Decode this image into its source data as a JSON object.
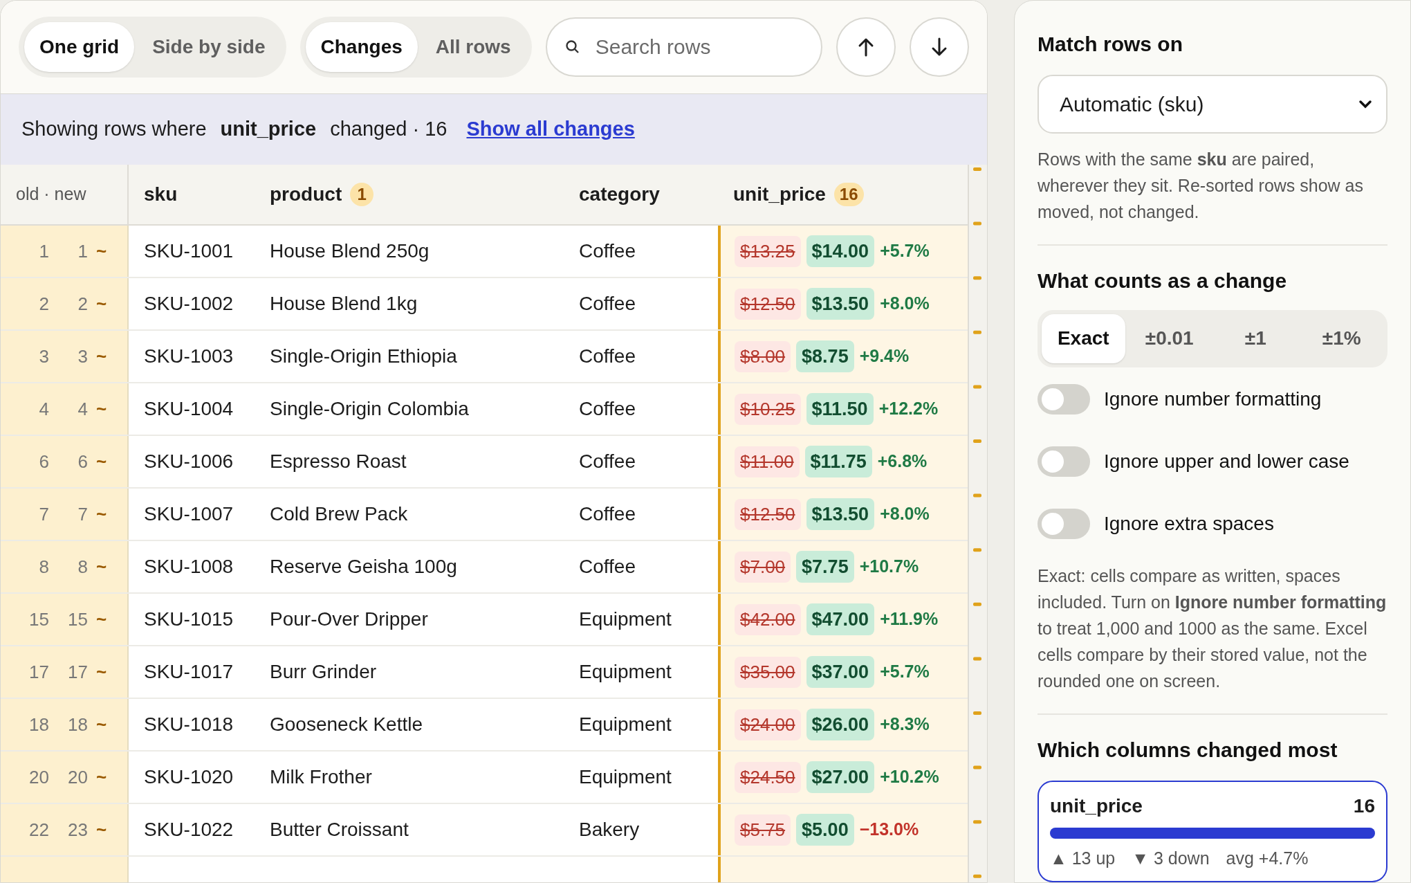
{
  "view_toggle": [
    {
      "label": "One grid",
      "selected": true
    },
    {
      "label": "Side by side",
      "selected": false
    }
  ],
  "rows_toggle": [
    {
      "label": "Changes",
      "selected": true
    },
    {
      "label": "All rows",
      "selected": false
    }
  ],
  "search": {
    "placeholder": "Search rows"
  },
  "filter_banner": {
    "prefix": "Showing rows where",
    "column": "unit_price",
    "suffix": "changed · 16",
    "link": "Show all changes"
  },
  "table": {
    "columns": [
      {
        "label": "old · new"
      },
      {
        "label": "sku"
      },
      {
        "label": "product",
        "badge": "1"
      },
      {
        "label": "category"
      },
      {
        "label": "unit_price",
        "badge": "16"
      }
    ],
    "rows": [
      {
        "old": "1",
        "new": "1",
        "mark": "~",
        "sku": "SKU-1001",
        "product": "House Blend 250g",
        "category": "Coffee",
        "old_price": "$13.25",
        "new_price": "$14.00",
        "delta": "+5.7%",
        "decrease": false
      },
      {
        "old": "2",
        "new": "2",
        "mark": "~",
        "sku": "SKU-1002",
        "product": "House Blend 1kg",
        "category": "Coffee",
        "old_price": "$12.50",
        "new_price": "$13.50",
        "delta": "+8.0%",
        "decrease": false
      },
      {
        "old": "3",
        "new": "3",
        "mark": "~",
        "sku": "SKU-1003",
        "product": "Single-Origin Ethiopia",
        "category": "Coffee",
        "old_price": "$8.00",
        "new_price": "$8.75",
        "delta": "+9.4%",
        "decrease": false
      },
      {
        "old": "4",
        "new": "4",
        "mark": "~",
        "sku": "SKU-1004",
        "product": "Single-Origin Colombia",
        "category": "Coffee",
        "old_price": "$10.25",
        "new_price": "$11.50",
        "delta": "+12.2%",
        "decrease": false
      },
      {
        "old": "6",
        "new": "6",
        "mark": "~",
        "sku": "SKU-1006",
        "product": "Espresso Roast",
        "category": "Coffee",
        "old_price": "$11.00",
        "new_price": "$11.75",
        "delta": "+6.8%",
        "decrease": false
      },
      {
        "old": "7",
        "new": "7",
        "mark": "~",
        "sku": "SKU-1007",
        "product": "Cold Brew Pack",
        "category": "Coffee",
        "old_price": "$12.50",
        "new_price": "$13.50",
        "delta": "+8.0%",
        "decrease": false
      },
      {
        "old": "8",
        "new": "8",
        "mark": "~",
        "sku": "SKU-1008",
        "product": "Reserve Geisha 100g",
        "category": "Coffee",
        "old_price": "$7.00",
        "new_price": "$7.75",
        "delta": "+10.7%",
        "decrease": false
      },
      {
        "old": "15",
        "new": "15",
        "mark": "~",
        "sku": "SKU-1015",
        "product": "Pour-Over Dripper",
        "category": "Equipment",
        "old_price": "$42.00",
        "new_price": "$47.00",
        "delta": "+11.9%",
        "decrease": false
      },
      {
        "old": "17",
        "new": "17",
        "mark": "~",
        "sku": "SKU-1017",
        "product": "Burr Grinder",
        "category": "Equipment",
        "old_price": "$35.00",
        "new_price": "$37.00",
        "delta": "+5.7%",
        "decrease": false
      },
      {
        "old": "18",
        "new": "18",
        "mark": "~",
        "sku": "SKU-1018",
        "product": "Gooseneck Kettle",
        "category": "Equipment",
        "old_price": "$24.00",
        "new_price": "$26.00",
        "delta": "+8.3%",
        "decrease": false
      },
      {
        "old": "20",
        "new": "20",
        "mark": "~",
        "sku": "SKU-1020",
        "product": "Milk Frother",
        "category": "Equipment",
        "old_price": "$24.50",
        "new_price": "$27.00",
        "delta": "+10.2%",
        "decrease": false
      },
      {
        "old": "22",
        "new": "23",
        "mark": "~",
        "sku": "SKU-1022",
        "product": "Butter Croissant",
        "category": "Bakery",
        "old_price": "$5.75",
        "new_price": "$5.00",
        "delta": "−13.0%",
        "decrease": true
      }
    ]
  },
  "panel": {
    "match": {
      "heading": "Match rows on",
      "select": "Automatic (sku)",
      "note": "Rows with the same **sku** are paired, wherever they sit. Re-sorted rows show as moved, not changed."
    },
    "change": {
      "heading": "What counts as a change",
      "tolerances": [
        {
          "label": "Exact",
          "selected": true
        },
        {
          "label": "±0.01",
          "selected": false
        },
        {
          "label": "±1",
          "selected": false
        },
        {
          "label": "±1%",
          "selected": false
        }
      ],
      "toggles": [
        {
          "label": "Ignore number formatting",
          "on": false
        },
        {
          "label": "Ignore upper and lower case",
          "on": false
        },
        {
          "label": "Ignore extra spaces",
          "on": false
        }
      ],
      "note": "Exact: cells compare as written, spaces included. Turn on **Ignore number formatting** to treat 1,000 and 1000 as the same. Excel cells compare by their stored value, not the rounded one on screen."
    },
    "columns_changed": {
      "heading": "Which columns changed most",
      "items": [
        {
          "name": "unit_price",
          "count": "16",
          "level": 1,
          "up": "▲ 13 up",
          "down": "▼ 3 down",
          "avg": "avg +4.7%",
          "selected": true
        }
      ]
    }
  }
}
